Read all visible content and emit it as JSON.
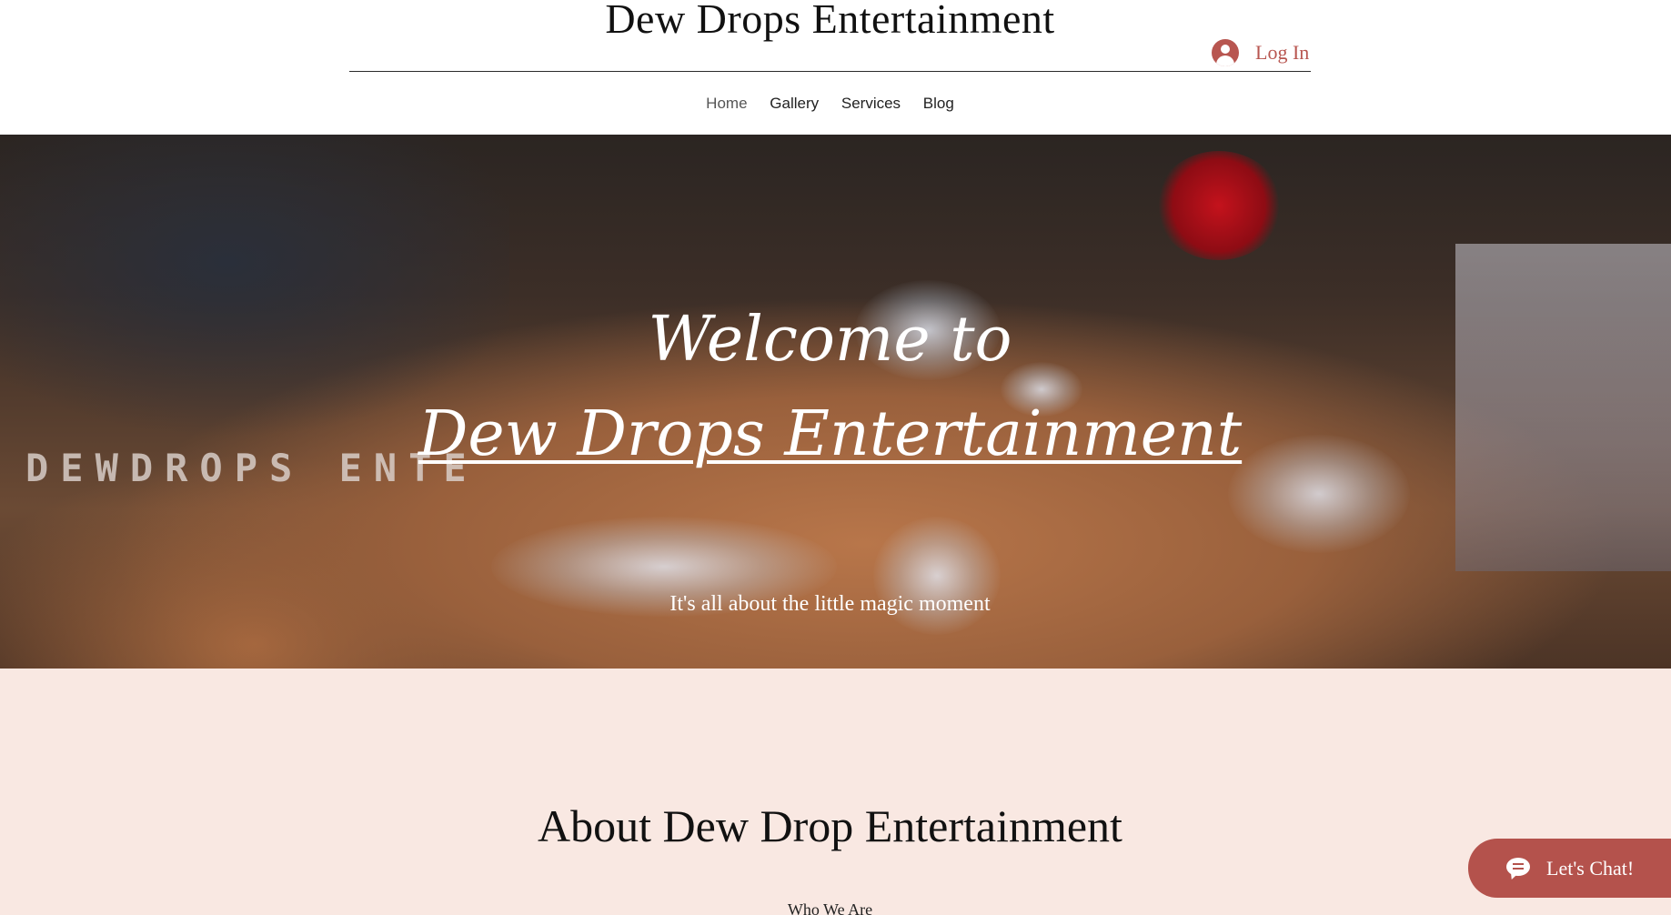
{
  "header": {
    "site_title": "Dew Drops Entertainment",
    "login_label": "Log In",
    "nav": [
      {
        "label": "Home",
        "active": true
      },
      {
        "label": "Gallery",
        "active": false
      },
      {
        "label": "Services",
        "active": false
      },
      {
        "label": "Blog",
        "active": false
      }
    ]
  },
  "hero": {
    "welcome": "Welcome to",
    "name": "Dew Drops Entertainment",
    "tagline": "It's all about the little magic moment",
    "watermark": "DEWDROPS ENTE"
  },
  "about": {
    "title": "About Dew Drop Entertainment",
    "subtitle": "Who We Are"
  },
  "chat": {
    "label": "Let's Chat!"
  },
  "colors": {
    "accent": "#b85650",
    "about_background": "#f9e8e2",
    "chat_background": "#b4524c"
  },
  "icons": {
    "login": "user-avatar-icon",
    "chat": "chat-bubble-icon"
  }
}
